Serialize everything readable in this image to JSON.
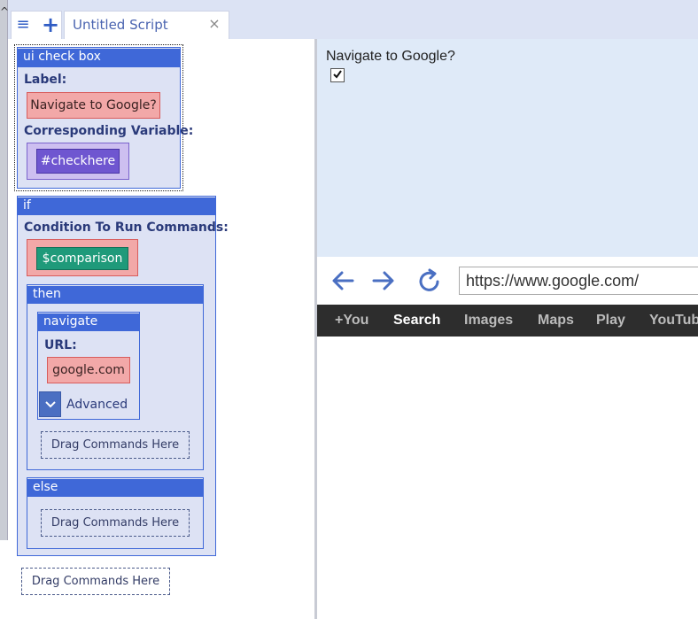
{
  "tab": {
    "title": "Untitled Script",
    "menu_icon": "≡",
    "add_icon": "+",
    "close_icon": "×"
  },
  "editor": {
    "checkbox_block": {
      "title": "ui check box",
      "label_heading": "Label:",
      "label_value": "Navigate to Google?",
      "variable_heading": "Corresponding Variable:",
      "variable_value": "#checkhere"
    },
    "if_block": {
      "title": "if",
      "condition_heading": "Condition To Run Commands:",
      "condition_value": "$comparison",
      "then": {
        "title": "then",
        "navigate": {
          "title": "navigate",
          "url_heading": "URL:",
          "url_value": "google.com",
          "advanced_label": "Advanced"
        },
        "drag_placeholder": "Drag Commands Here"
      },
      "else": {
        "title": "else",
        "drag_placeholder": "Drag Commands Here"
      }
    },
    "root_drag_placeholder": "Drag Commands Here"
  },
  "preview": {
    "checkbox_label": "Navigate to Google?",
    "checked": true
  },
  "browser": {
    "url": "https://www.google.com/",
    "gbar_items": [
      {
        "label": "+You",
        "active": false
      },
      {
        "label": "Search",
        "active": true
      },
      {
        "label": "Images",
        "active": false
      },
      {
        "label": "Maps",
        "active": false
      },
      {
        "label": "Play",
        "active": false
      },
      {
        "label": "YouTube",
        "active": false
      }
    ]
  },
  "colors": {
    "accent": "#3f68d8",
    "block_bg": "#dde2f4",
    "string_pill": "#f2a8a8",
    "variable_pill": "#6f56d0",
    "condition_pill": "#1f9a7a",
    "gbar_bg": "#2d2d2d"
  }
}
